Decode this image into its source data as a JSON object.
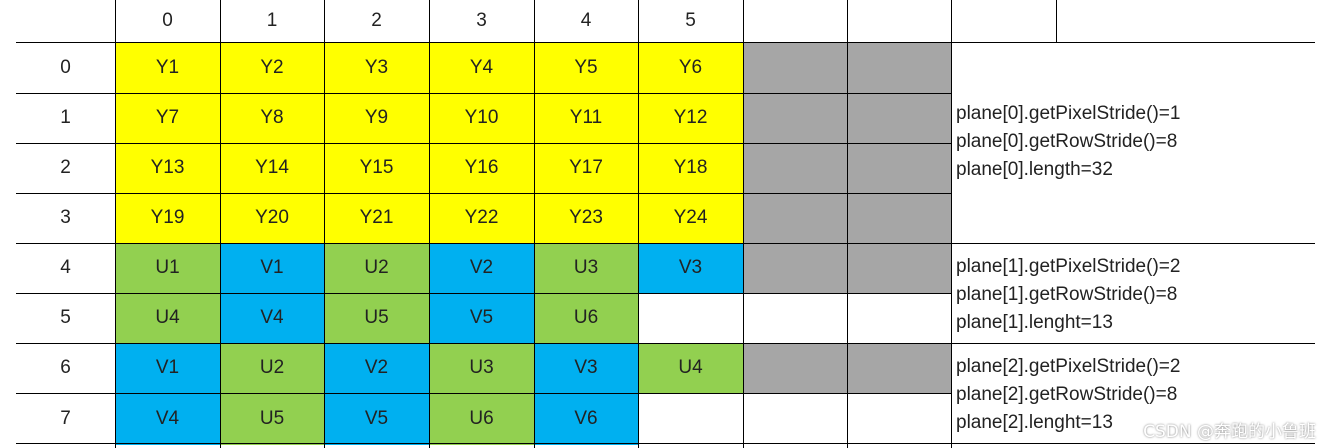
{
  "column_headers": [
    "0",
    "1",
    "2",
    "3",
    "4",
    "5"
  ],
  "row_headers": [
    "0",
    "1",
    "2",
    "3",
    "4",
    "5",
    "6",
    "7"
  ],
  "rows": [
    [
      {
        "text": "Y1",
        "color": "#ffff00"
      },
      {
        "text": "Y2",
        "color": "#ffff00"
      },
      {
        "text": "Y3",
        "color": "#ffff00"
      },
      {
        "text": "Y4",
        "color": "#ffff00"
      },
      {
        "text": "Y5",
        "color": "#ffff00"
      },
      {
        "text": "Y6",
        "color": "#ffff00"
      },
      {
        "text": "",
        "color": "#a6a6a6"
      },
      {
        "text": "",
        "color": "#a6a6a6"
      }
    ],
    [
      {
        "text": "Y7",
        "color": "#ffff00"
      },
      {
        "text": "Y8",
        "color": "#ffff00"
      },
      {
        "text": "Y9",
        "color": "#ffff00"
      },
      {
        "text": "Y10",
        "color": "#ffff00"
      },
      {
        "text": "Y11",
        "color": "#ffff00"
      },
      {
        "text": "Y12",
        "color": "#ffff00"
      },
      {
        "text": "",
        "color": "#a6a6a6"
      },
      {
        "text": "",
        "color": "#a6a6a6"
      }
    ],
    [
      {
        "text": "Y13",
        "color": "#ffff00"
      },
      {
        "text": "Y14",
        "color": "#ffff00"
      },
      {
        "text": "Y15",
        "color": "#ffff00"
      },
      {
        "text": "Y16",
        "color": "#ffff00"
      },
      {
        "text": "Y17",
        "color": "#ffff00"
      },
      {
        "text": "Y18",
        "color": "#ffff00"
      },
      {
        "text": "",
        "color": "#a6a6a6"
      },
      {
        "text": "",
        "color": "#a6a6a6"
      }
    ],
    [
      {
        "text": "Y19",
        "color": "#ffff00"
      },
      {
        "text": "Y20",
        "color": "#ffff00"
      },
      {
        "text": "Y21",
        "color": "#ffff00"
      },
      {
        "text": "Y22",
        "color": "#ffff00"
      },
      {
        "text": "Y23",
        "color": "#ffff00"
      },
      {
        "text": "Y24",
        "color": "#ffff00"
      },
      {
        "text": "",
        "color": "#a6a6a6"
      },
      {
        "text": "",
        "color": "#a6a6a6"
      }
    ],
    [
      {
        "text": "U1",
        "color": "#92d050"
      },
      {
        "text": "V1",
        "color": "#00b0f0"
      },
      {
        "text": "U2",
        "color": "#92d050"
      },
      {
        "text": "V2",
        "color": "#00b0f0"
      },
      {
        "text": "U3",
        "color": "#92d050"
      },
      {
        "text": "V3",
        "color": "#00b0f0"
      },
      {
        "text": "",
        "color": "#a6a6a6"
      },
      {
        "text": "",
        "color": "#a6a6a6"
      }
    ],
    [
      {
        "text": "U4",
        "color": "#92d050"
      },
      {
        "text": "V4",
        "color": "#00b0f0"
      },
      {
        "text": "U5",
        "color": "#92d050"
      },
      {
        "text": "V5",
        "color": "#00b0f0"
      },
      {
        "text": "U6",
        "color": "#92d050"
      },
      {
        "text": "",
        "color": "#ffffff"
      },
      {
        "text": "",
        "color": "#ffffff"
      },
      {
        "text": "",
        "color": "#ffffff"
      }
    ],
    [
      {
        "text": "V1",
        "color": "#00b0f0"
      },
      {
        "text": "U2",
        "color": "#92d050"
      },
      {
        "text": "V2",
        "color": "#00b0f0"
      },
      {
        "text": "U3",
        "color": "#92d050"
      },
      {
        "text": "V3",
        "color": "#00b0f0"
      },
      {
        "text": "U4",
        "color": "#92d050"
      },
      {
        "text": "",
        "color": "#a6a6a6"
      },
      {
        "text": "",
        "color": "#a6a6a6"
      }
    ],
    [
      {
        "text": "V4",
        "color": "#00b0f0"
      },
      {
        "text": "U5",
        "color": "#92d050"
      },
      {
        "text": "V5",
        "color": "#00b0f0"
      },
      {
        "text": "U6",
        "color": "#92d050"
      },
      {
        "text": "V6",
        "color": "#00b0f0"
      },
      {
        "text": "",
        "color": "#ffffff"
      },
      {
        "text": "",
        "color": "#ffffff"
      },
      {
        "text": "",
        "color": "#ffffff"
      }
    ]
  ],
  "notes": {
    "plane0": [
      "plane[0].getPixelStride()=1",
      "plane[0].getRowStride()=8",
      "plane[0].length=32"
    ],
    "plane1": [
      "plane[1].getPixelStride()=2",
      "plane[1].getRowStride()=8",
      "plane[1].lenght=13"
    ],
    "plane2": [
      "plane[2].getPixelStride()=2",
      "plane[2].getRowStride()=8",
      "plane[2].lenght=13"
    ]
  },
  "watermark": "CSDN @奔跑的小鲁班",
  "colors": {
    "y": "#ffff00",
    "u": "#92d050",
    "v": "#00b0f0",
    "padding": "#a6a6a6"
  }
}
